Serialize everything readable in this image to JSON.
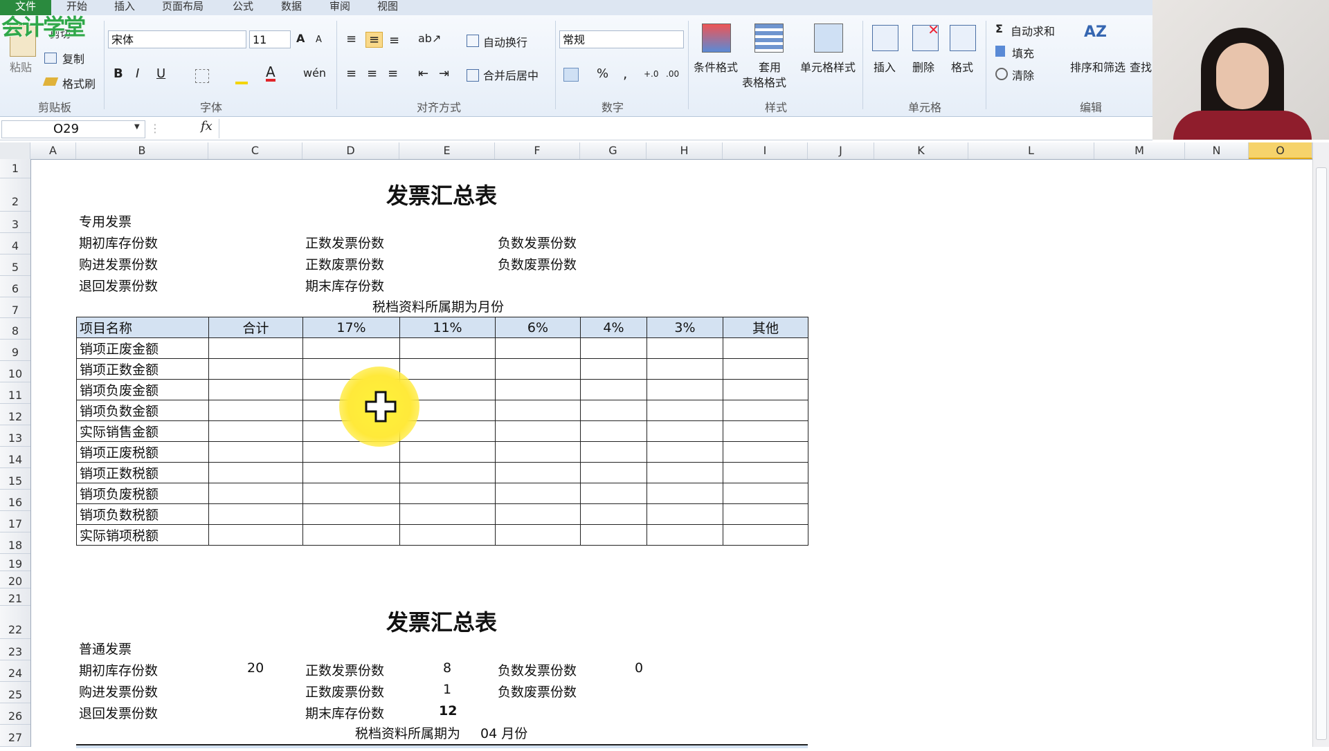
{
  "ribbon": {
    "file_tab": "文件",
    "tabs": [
      "开始",
      "插入",
      "页面布局",
      "公式",
      "数据",
      "审阅",
      "视图"
    ],
    "logo": "会计学堂",
    "clipboard": {
      "paste": "粘贴",
      "cut": "剪切",
      "copy": "复制",
      "format_painter": "格式刷",
      "label": "剪贴板"
    },
    "font": {
      "name": "宋体",
      "size": "11",
      "bold": "B",
      "italic": "I",
      "underline": "U",
      "label": "字体",
      "phonetic": "wén"
    },
    "alignment": {
      "wrap": "自动换行",
      "merge": "合并后居中",
      "label": "对齐方式"
    },
    "number": {
      "format": "常规",
      "percent": "%",
      "comma": ",",
      "inc": "+.0",
      "dec": ".00",
      "label": "数字"
    },
    "styles": {
      "cond": "条件格式",
      "table_fmt_1": "套用",
      "table_fmt_2": "表格格式",
      "cell_styles": "单元格样式",
      "label": "样式"
    },
    "cells": {
      "insert": "插入",
      "delete": "删除",
      "format": "格式",
      "label": "单元格"
    },
    "editing": {
      "autosum": "自动求和",
      "fill": "填充",
      "clear": "清除",
      "sort": "排序和筛选",
      "find": "查找",
      "label": "编辑"
    }
  },
  "formula_bar": {
    "name_box": "O29",
    "fx": "fx",
    "value": ""
  },
  "columns": [
    "A",
    "B",
    "C",
    "D",
    "E",
    "F",
    "G",
    "H",
    "I",
    "J",
    "K",
    "L",
    "M",
    "N",
    "O"
  ],
  "selected_column": "O",
  "rows": [
    "1",
    "2",
    "3",
    "4",
    "5",
    "6",
    "7",
    "8",
    "9",
    "10",
    "11",
    "12",
    "13",
    "14",
    "15",
    "16",
    "17",
    "18",
    "19",
    "20",
    "21",
    "22",
    "23",
    "24",
    "25",
    "26",
    "27"
  ],
  "sheet": {
    "section1": {
      "title": "发票汇总表",
      "type": "专用发票",
      "left_labels": [
        "期初库存份数",
        "购进发票份数",
        "退回发票份数"
      ],
      "mid_labels": [
        "正数发票份数",
        "正数废票份数",
        "期末库存份数"
      ],
      "right_labels": [
        "负数发票份数",
        "负数废票份数"
      ],
      "period": "税档资料所属期为月份",
      "table_headers": [
        "项目名称",
        "合计",
        "17%",
        "11%",
        "6%",
        "4%",
        "3%",
        "其他"
      ],
      "table_rows": [
        "销项正废金额",
        "销项正数金额",
        "销项负废金额",
        "销项负数金额",
        "实际销售金额",
        "销项正废税额",
        "销项正数税额",
        "销项负废税额",
        "销项负数税额",
        "实际销项税额"
      ]
    },
    "section2": {
      "title": "发票汇总表",
      "type": "普通发票",
      "left_labels": [
        "期初库存份数",
        "购进发票份数",
        "退回发票份数"
      ],
      "left_values": [
        "20",
        "",
        ""
      ],
      "mid_labels": [
        "正数发票份数",
        "正数废票份数",
        "期末库存份数"
      ],
      "mid_values": [
        "8",
        "1",
        "12"
      ],
      "right_labels": [
        "负数发票份数",
        "负数废票份数"
      ],
      "right_values": [
        "0",
        ""
      ],
      "period_prefix": "税档资料所属期为",
      "period_month": "04 月份"
    }
  },
  "colors": {
    "header_fill": "#d4e2f2",
    "selected_col": "#f6d36b",
    "cursor_highlight": "#ffef3a",
    "logo": "#2fa84a"
  }
}
